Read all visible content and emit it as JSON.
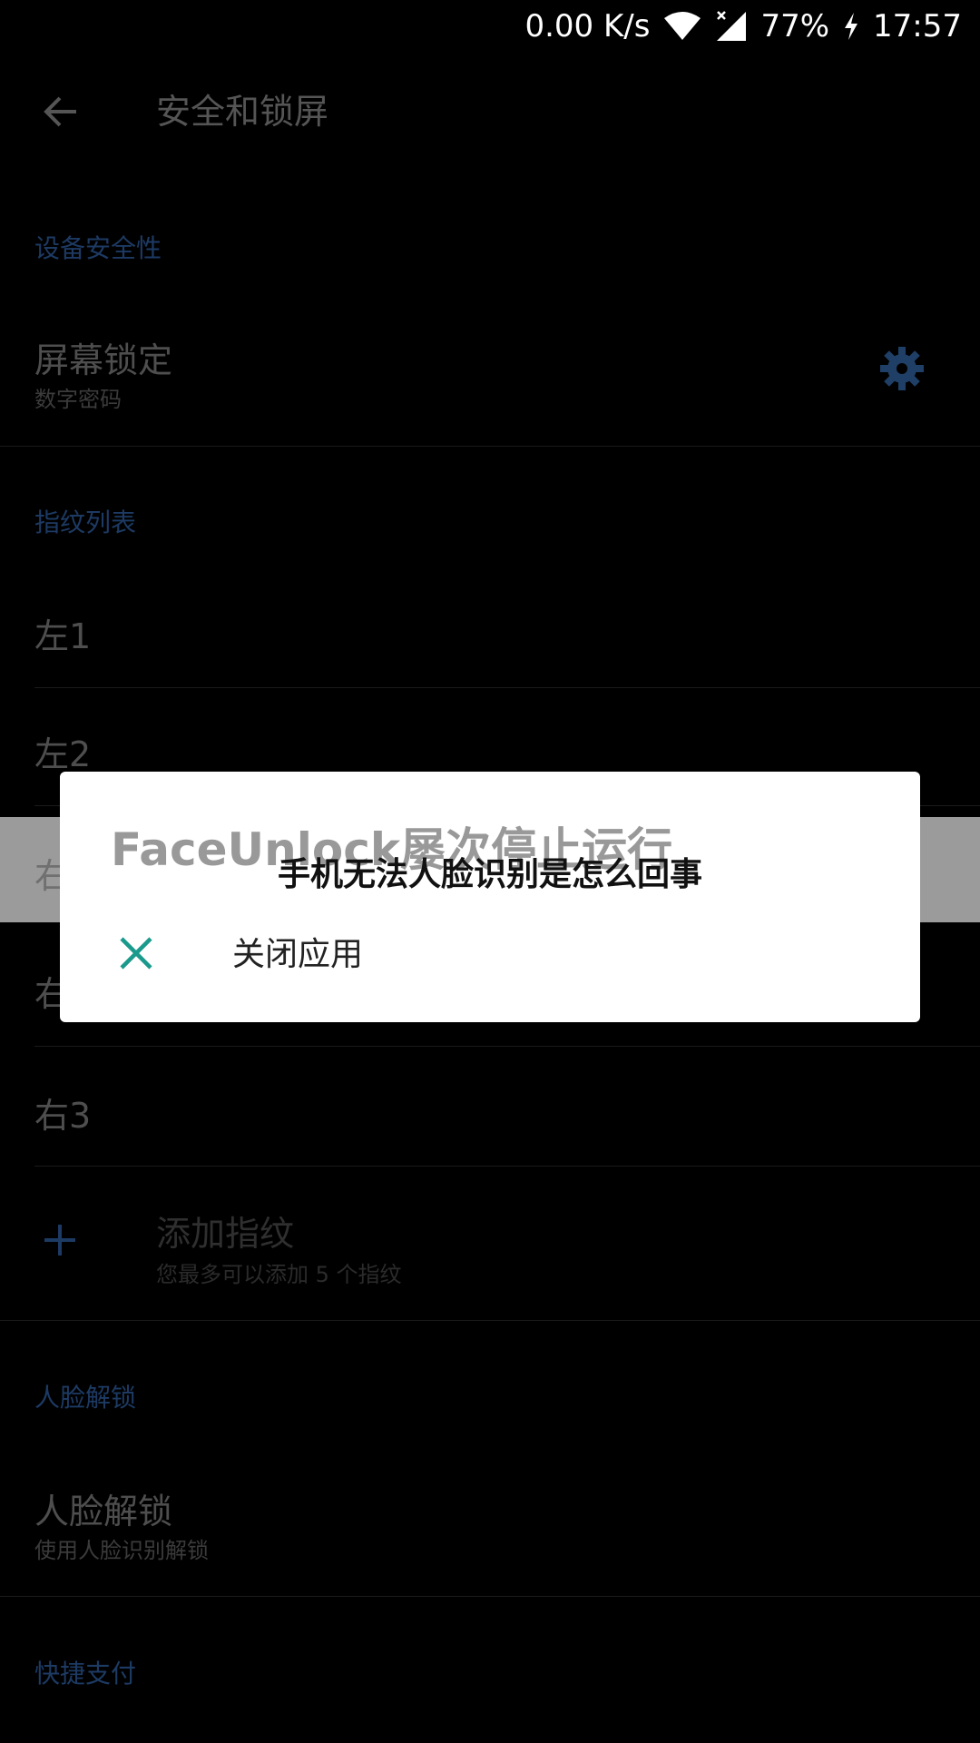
{
  "status_bar": {
    "network_speed": "0.00 K/s",
    "battery": "77%",
    "time": "17:57"
  },
  "app_bar": {
    "title": "安全和锁屏"
  },
  "sections": {
    "device_security": {
      "header": "设备安全性",
      "screen_lock": {
        "title": "屏幕锁定",
        "subtitle": "数字密码"
      }
    },
    "fingerprints": {
      "header": "指纹列表",
      "items": [
        "左1",
        "左2",
        "右",
        "右",
        "右3"
      ],
      "add": {
        "title": "添加指纹",
        "subtitle": "您最多可以添加 5 个指纹"
      }
    },
    "face_unlock": {
      "header": "人脸解锁",
      "item": {
        "title": "人脸解锁",
        "subtitle": "使用人脸识别解锁"
      }
    },
    "quick_pay": {
      "header": "快捷支付"
    }
  },
  "dialog": {
    "title": "FaceUnlock屡次停止运行",
    "close_label": "关闭应用"
  },
  "watermark": "手机无法人脸识别是怎么回事",
  "colors": {
    "background": "#000000",
    "section_header": "#1d3a63",
    "dialog_bg": "#ffffff",
    "close_icon": "#1a9a8c",
    "gear_icon": "#1f3f66"
  }
}
